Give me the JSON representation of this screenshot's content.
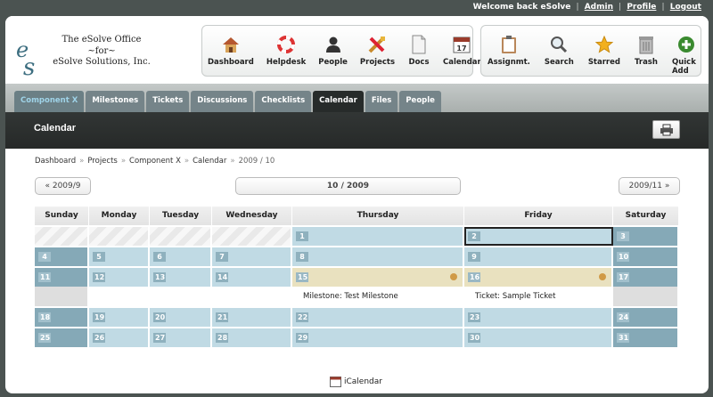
{
  "topbar": {
    "welcome": "Welcome back eSolve",
    "admin": "Admin",
    "profile": "Profile",
    "logout": "Logout",
    "sep": "|"
  },
  "brand": {
    "line1": "The eSolve Office",
    "line2": "~for~",
    "line3": "eSolve Solutions, Inc."
  },
  "mainnav": [
    {
      "label": "Dashboard",
      "icon": "house-icon"
    },
    {
      "label": "Helpdesk",
      "icon": "lifebuoy-icon"
    },
    {
      "label": "People",
      "icon": "person-icon"
    },
    {
      "label": "Projects",
      "icon": "tools-icon"
    },
    {
      "label": "Docs",
      "icon": "document-icon"
    },
    {
      "label": "Calendar",
      "icon": "calendar-icon"
    }
  ],
  "toolnav": [
    {
      "label": "Assignmt.",
      "icon": "clipboard-icon"
    },
    {
      "label": "Search",
      "icon": "magnifier-icon"
    },
    {
      "label": "Starred",
      "icon": "star-icon"
    },
    {
      "label": "Trash",
      "icon": "trash-icon"
    },
    {
      "label": "Quick Add",
      "icon": "plus-icon"
    }
  ],
  "tabs": [
    "Component X",
    "Milestones",
    "Tickets",
    "Discussions",
    "Checklists",
    "Calendar",
    "Files",
    "People"
  ],
  "page": {
    "title": "Calendar"
  },
  "breadcrumb": {
    "items": [
      "Dashboard",
      "Projects",
      "Component X",
      "Calendar"
    ],
    "current": "2009 / 10",
    "sep": "»"
  },
  "monthnav": {
    "prev": "« 2009/9",
    "current": "10 / 2009",
    "next": "2009/11 »"
  },
  "calendar": {
    "days": [
      "Sunday",
      "Monday",
      "Tuesday",
      "Wednesday",
      "Thursday",
      "Friday",
      "Saturday"
    ],
    "weeks": [
      [
        "",
        "",
        "",
        "",
        "1",
        "2",
        "3"
      ],
      [
        "4",
        "5",
        "6",
        "7",
        "8",
        "9",
        "10"
      ],
      [
        "11",
        "12",
        "13",
        "14",
        "15",
        "16",
        "17"
      ],
      [
        "18",
        "19",
        "20",
        "21",
        "22",
        "23",
        "24"
      ],
      [
        "25",
        "26",
        "27",
        "28",
        "29",
        "30",
        "31"
      ]
    ],
    "events": [
      {
        "day": "15",
        "label": "Milestone: Test Milestone"
      },
      {
        "day": "16",
        "label": "Ticket: Sample Ticket"
      }
    ]
  },
  "ical": {
    "label": "iCalendar"
  }
}
